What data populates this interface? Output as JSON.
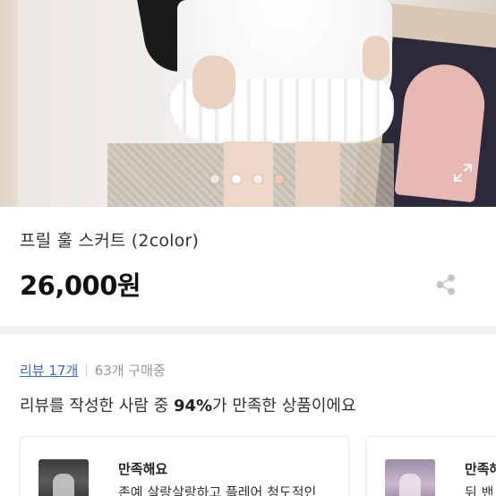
{
  "gallery": {
    "dot_count": 4,
    "active_index": 1
  },
  "product": {
    "title": "프릴 훌 스커트 (2color)",
    "price": "26,000원"
  },
  "reviews": {
    "link_label": "리뷰 17개",
    "buyers": "63개 구매중",
    "summary_prefix": "리뷰를 작성한 사람 중 ",
    "summary_percent": "94%",
    "summary_suffix": "가 만족한 상품이에요",
    "cards": [
      {
        "title": "만족해요",
        "text": "존예 살랑살랑하고 플레어 청도적인"
      },
      {
        "title": "만족해요",
        "text": "뒤 밴"
      }
    ]
  },
  "icons": {
    "expand": "expand-icon",
    "share": "share-icon"
  },
  "colors": {
    "link": "#3a6ccf",
    "divider": "#f1f2f4"
  }
}
